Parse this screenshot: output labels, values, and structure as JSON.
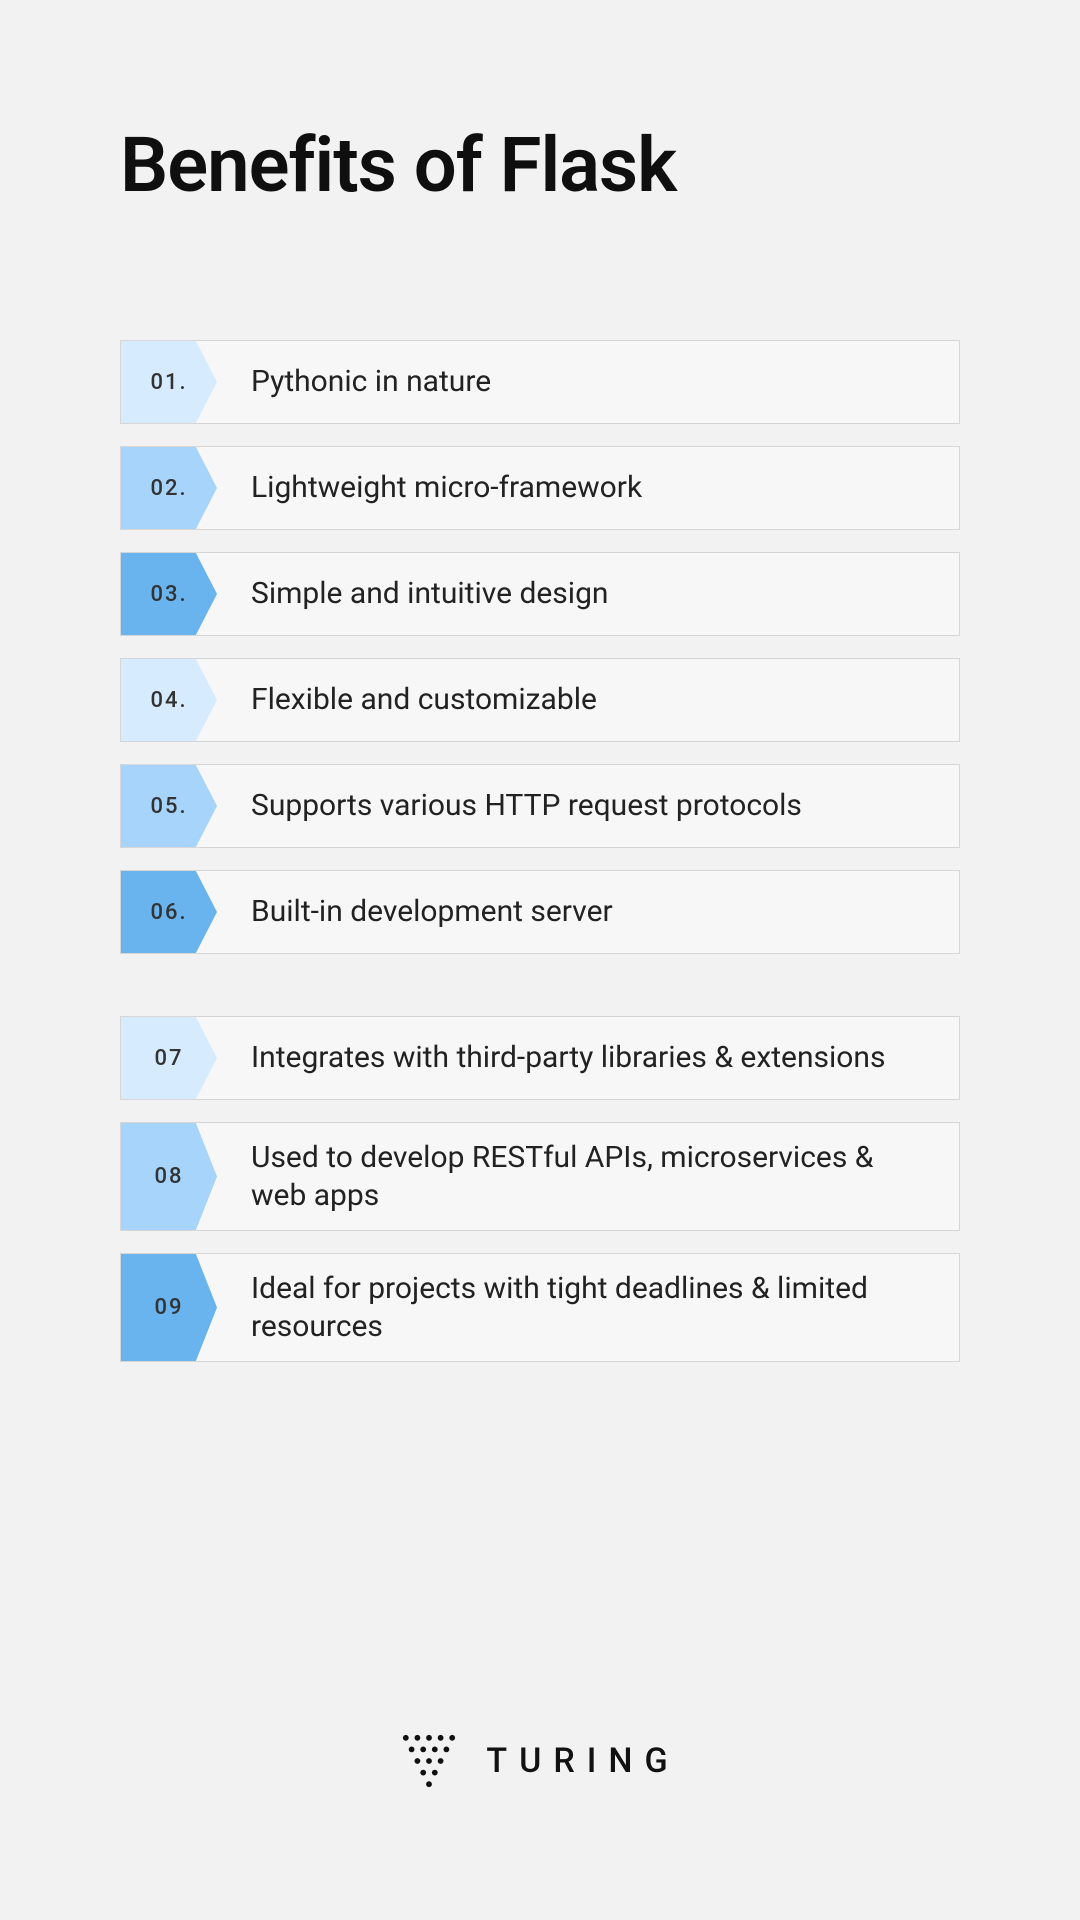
{
  "title": "Benefits of Flask",
  "items": [
    {
      "num": "01.",
      "text": "Pythonic in nature",
      "color": "#d6ecfe"
    },
    {
      "num": "02.",
      "text": "Lightweight micro-framework",
      "color": "#a7d4fb"
    },
    {
      "num": "03.",
      "text": "Simple and intuitive design",
      "color": "#69b3ee"
    },
    {
      "num": "04.",
      "text": "Flexible and customizable",
      "color": "#d6ecfe"
    },
    {
      "num": "05.",
      "text": "Supports various HTTP request protocols",
      "color": "#a7d4fb"
    },
    {
      "num": "06.",
      "text": "Built-in development server",
      "color": "#69b3ee"
    },
    {
      "num": "07",
      "text": "Integrates with third-party libraries & extensions",
      "color": "#d6ecfe"
    },
    {
      "num": "08",
      "text": "Used to develop RESTful APIs, microservices & web apps",
      "color": "#a7d4fb"
    },
    {
      "num": "09",
      "text": "Ideal for projects with tight deadlines & limited resources",
      "color": "#69b3ee"
    }
  ],
  "brand": {
    "name": "TURING"
  }
}
